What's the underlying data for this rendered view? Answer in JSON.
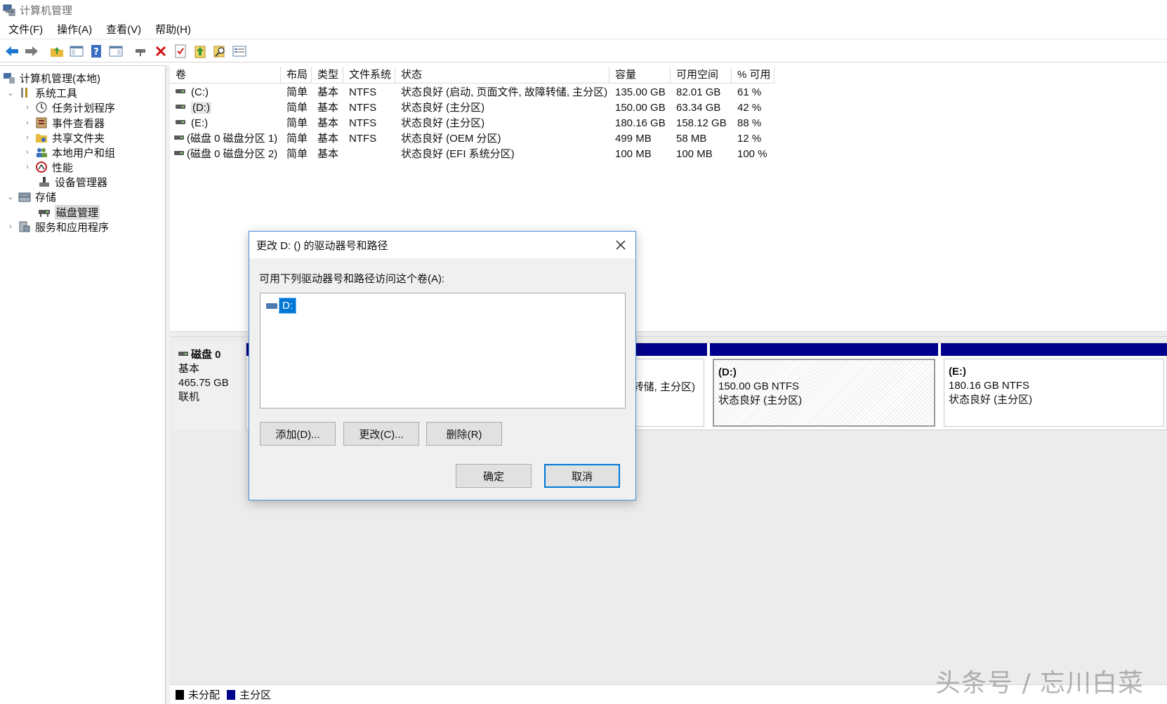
{
  "window": {
    "title": "计算机管理"
  },
  "menu": [
    "文件(F)",
    "操作(A)",
    "查看(V)",
    "帮助(H)"
  ],
  "toolbar": {
    "icons": [
      "back-arrow-icon",
      "forward-arrow-icon",
      "up-folder-icon",
      "show-hide-console-tree-icon",
      "help-icon",
      "show-hide-action-pane-icon",
      "connect-drive-icon",
      "delete-icon",
      "properties-icon",
      "export-list-icon",
      "find-icon",
      "options-icon"
    ]
  },
  "tree": {
    "root": "计算机管理(本地)",
    "system_tools": "系统工具",
    "task_scheduler": "任务计划程序",
    "event_viewer": "事件查看器",
    "shared_folders": "共享文件夹",
    "local_users": "本地用户和组",
    "performance": "性能",
    "device_manager": "设备管理器",
    "storage": "存储",
    "disk_management": "磁盘管理",
    "services_apps": "服务和应用程序"
  },
  "volume_table": {
    "headers": [
      "卷",
      "布局",
      "类型",
      "文件系统",
      "状态",
      "容量",
      "可用空间",
      "% 可用"
    ],
    "rows": [
      [
        "(C:)",
        "简单",
        "基本",
        "NTFS",
        "状态良好 (启动, 页面文件, 故障转储, 主分区)",
        "135.00 GB",
        "82.01 GB",
        "61 %"
      ],
      [
        "(D:)",
        "简单",
        "基本",
        "NTFS",
        "状态良好 (主分区)",
        "150.00 GB",
        "63.34 GB",
        "42 %"
      ],
      [
        "(E:)",
        "简单",
        "基本",
        "NTFS",
        "状态良好 (主分区)",
        "180.16 GB",
        "158.12 GB",
        "88 %"
      ],
      [
        "(磁盘 0 磁盘分区 1)",
        "简单",
        "基本",
        "NTFS",
        "状态良好 (OEM 分区)",
        "499 MB",
        "58 MB",
        "12 %"
      ],
      [
        "(磁盘 0 磁盘分区 2)",
        "简单",
        "基本",
        "",
        "状态良好 (EFI 系统分区)",
        "100 MB",
        "100 MB",
        "100 %"
      ]
    ]
  },
  "disk": {
    "name": "磁盘 0",
    "type": "基本",
    "size": "465.75 GB",
    "status": "联机",
    "partial_status": "转储, 主分区)",
    "partitions": [
      {
        "name": "(D:)",
        "size": "150.00 GB NTFS",
        "status": "状态良好 (主分区)"
      },
      {
        "name": "(E:)",
        "size": "180.16 GB NTFS",
        "status": "状态良好 (主分区)"
      }
    ]
  },
  "legend": {
    "unallocated": "未分配",
    "primary": "主分区",
    "unallocated_color": "#000000",
    "primary_color": "#00008b"
  },
  "dialog": {
    "title": "更改 D: () 的驱动器号和路径",
    "prompt": "可用下列驱动器号和路径访问这个卷(A):",
    "list_item": "D:",
    "add_label": "添加(D)...",
    "change_label": "更改(C)...",
    "remove_label": "删除(R)",
    "ok_label": "确定",
    "cancel_label": "取消"
  },
  "watermark": "头条号 / 忘川白菜"
}
